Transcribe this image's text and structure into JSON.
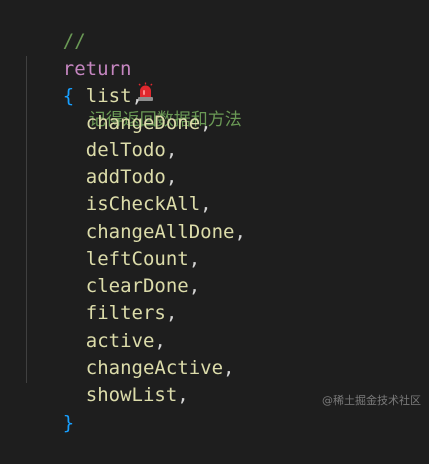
{
  "comment": {
    "prefix": "//",
    "icon": "siren-icon",
    "text": "记得返回数据和方法"
  },
  "code": {
    "keyword": "return",
    "open_brace": "{",
    "close_brace": "}",
    "items": [
      "list",
      "changeDone",
      "delTodo",
      "addTodo",
      "isCheckAll",
      "changeAllDone",
      "leftCount",
      "clearDone",
      "filters",
      "active",
      "changeActive",
      "showList"
    ],
    "separator": ","
  },
  "watermark": {
    "text": "@稀土掘金技术社区"
  },
  "colors": {
    "background": "#1e1e1e",
    "comment": "#6a9955",
    "keyword": "#c586c0",
    "brace": "#179fff",
    "identifier": "#dcdcaa",
    "punctuation": "#d4d4d4"
  }
}
